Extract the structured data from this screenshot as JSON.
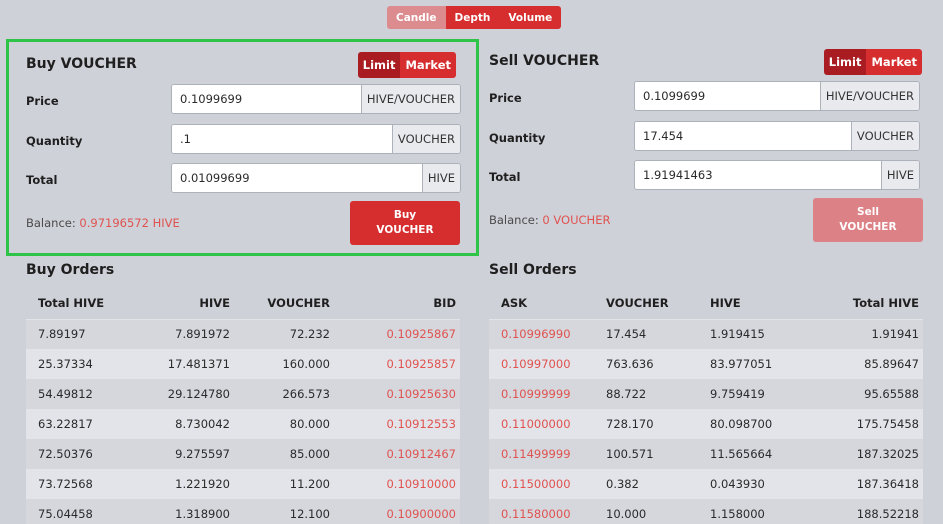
{
  "chart_tabs": [
    {
      "label": "Candle"
    },
    {
      "label": "Depth"
    },
    {
      "label": "Volume"
    }
  ],
  "buy_panel": {
    "title": "Buy VOUCHER",
    "toggle": {
      "limit": "Limit",
      "market": "Market"
    },
    "price": {
      "label": "Price",
      "value": "0.1099699",
      "unit": "HIVE/VOUCHER"
    },
    "quantity": {
      "label": "Quantity",
      "value": ".1",
      "unit": "VOUCHER"
    },
    "total": {
      "label": "Total",
      "value": "0.01099699",
      "unit": "HIVE"
    },
    "balance_label": "Balance:",
    "balance_value": "0.97196572 HIVE",
    "button_line1": "Buy",
    "button_line2": "VOUCHER"
  },
  "sell_panel": {
    "title": "Sell VOUCHER",
    "toggle": {
      "limit": "Limit",
      "market": "Market"
    },
    "price": {
      "label": "Price",
      "value": "0.1099699",
      "unit": "HIVE/VOUCHER"
    },
    "quantity": {
      "label": "Quantity",
      "value": "17.454",
      "unit": "VOUCHER"
    },
    "total": {
      "label": "Total",
      "value": "1.91941463",
      "unit": "HIVE"
    },
    "balance_label": "Balance:",
    "balance_value": "0 VOUCHER",
    "button_line1": "Sell",
    "button_line2": "VOUCHER"
  },
  "buy_orders": {
    "title": "Buy Orders",
    "headers": [
      "Total HIVE",
      "HIVE",
      "VOUCHER",
      "BID"
    ],
    "rows": [
      [
        "7.89197",
        "7.891972",
        "72.232",
        "0.10925867"
      ],
      [
        "25.37334",
        "17.481371",
        "160.000",
        "0.10925857"
      ],
      [
        "54.49812",
        "29.124780",
        "266.573",
        "0.10925630"
      ],
      [
        "63.22817",
        "8.730042",
        "80.000",
        "0.10912553"
      ],
      [
        "72.50376",
        "9.275597",
        "85.000",
        "0.10912467"
      ],
      [
        "73.72568",
        "1.221920",
        "11.200",
        "0.10910000"
      ],
      [
        "75.04458",
        "1.318900",
        "12.100",
        "0.10900000"
      ]
    ]
  },
  "sell_orders": {
    "title": "Sell Orders",
    "headers": [
      "ASK",
      "VOUCHER",
      "HIVE",
      "Total HIVE"
    ],
    "rows": [
      [
        "0.10996990",
        "17.454",
        "1.919415",
        "1.91941"
      ],
      [
        "0.10997000",
        "763.636",
        "83.977051",
        "85.89647"
      ],
      [
        "0.10999999",
        "88.722",
        "9.759419",
        "95.65588"
      ],
      [
        "0.11000000",
        "728.170",
        "80.098700",
        "175.75458"
      ],
      [
        "0.11499999",
        "100.571",
        "11.565664",
        "187.32025"
      ],
      [
        "0.11500000",
        "0.382",
        "0.043930",
        "187.36418"
      ],
      [
        "0.11580000",
        "10.000",
        "1.158000",
        "188.52218"
      ]
    ]
  },
  "colors": {
    "accent": "#d62d2f",
    "highlight_border": "#2ec447",
    "price_text": "#e0524f"
  }
}
